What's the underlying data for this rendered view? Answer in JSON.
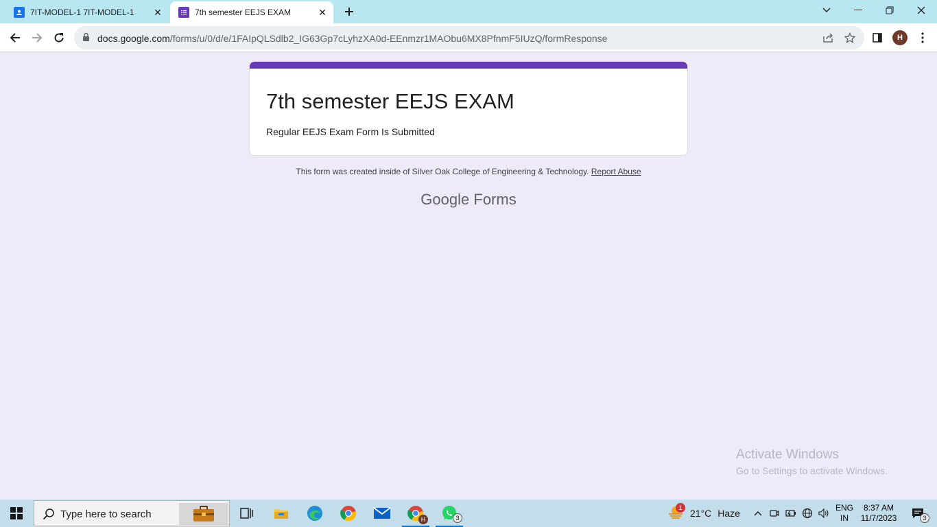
{
  "browser": {
    "tabs": [
      {
        "title": "7IT-MODEL-1 7IT-MODEL-1",
        "active": false,
        "icon": "classroom-person-icon"
      },
      {
        "title": "7th semester EEJS EXAM",
        "active": true,
        "icon": "forms-list-icon"
      }
    ],
    "url_host": "docs.google.com",
    "url_path": "/forms/u/0/d/e/1FAIpQLSdlb2_IG63Gp7cLyhzXA0d-EEnmzr1MAObu6MX8PfnmF5IUzQ/formResponse",
    "profile_initial": "H"
  },
  "form": {
    "title": "7th semester EEJS EXAM",
    "confirmation": "Regular EEJS Exam Form Is Submitted",
    "footer_text": "This form was created inside of Silver Oak College of Engineering & Technology.",
    "report_abuse": "Report Abuse",
    "logo_google": "Google",
    "logo_forms": "Forms",
    "accent_color": "#673ab7"
  },
  "watermark": {
    "heading": "Activate Windows",
    "subtext": "Go to Settings to activate Windows."
  },
  "taskbar": {
    "search_placeholder": "Type here to search",
    "whatsapp_badge": "3",
    "chrome_profile_badge": "H",
    "weather_alert": "1",
    "temperature": "21°C",
    "weather": "Haze",
    "lang_line1": "ENG",
    "lang_line2": "IN",
    "time": "8:37 AM",
    "date": "11/7/2023",
    "notification_count": "3"
  }
}
